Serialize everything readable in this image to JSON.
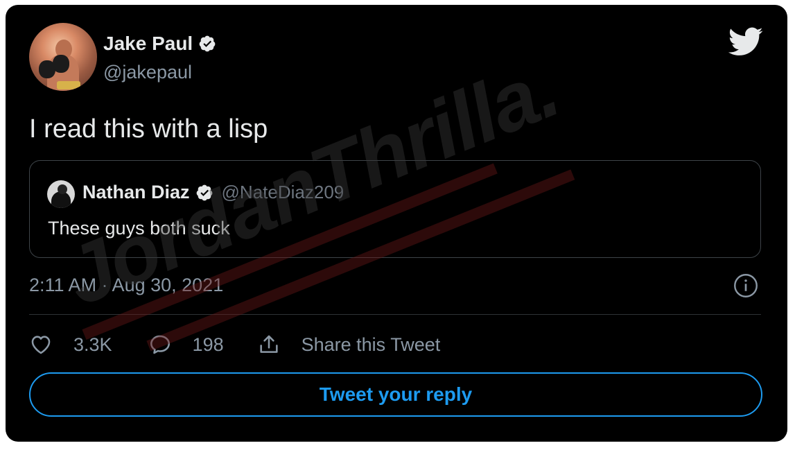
{
  "tweet": {
    "author_name": "Jake Paul",
    "author_handle": "@jakepaul",
    "text": "I read this with a lisp",
    "timestamp": "2:11 AM · Aug 30, 2021"
  },
  "quote": {
    "author_name": "Nathan Diaz",
    "author_handle": "@NateDiaz209",
    "text": "These guys both suck"
  },
  "actions": {
    "like_count": "3.3K",
    "reply_count": "198",
    "share_label": "Share this Tweet"
  },
  "reply_button_label": "Tweet your reply",
  "watermark": "JordanThrilla.",
  "icons": {
    "brand": "twitter-bird-icon",
    "verified": "verified-badge-icon",
    "info": "info-icon",
    "like": "heart-icon",
    "reply": "comment-icon",
    "share": "share-icon"
  },
  "colors": {
    "background": "#000000",
    "text_primary": "#e7e9ea",
    "text_secondary": "#8b98a5",
    "accent": "#1d9bf0",
    "border": "#3e4449"
  }
}
